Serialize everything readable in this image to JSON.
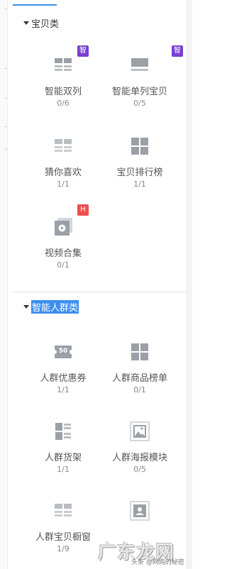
{
  "sections": [
    {
      "title": "宝贝类",
      "items": [
        {
          "label": "智能双列",
          "count": "0/6",
          "icon": "double-column-icon",
          "badge": "智"
        },
        {
          "label": "智能单列宝贝",
          "count": "0/5",
          "icon": "single-column-icon",
          "badge": "智"
        },
        {
          "label": "猜你喜欢",
          "count": "1/1",
          "icon": "double-column-icon"
        },
        {
          "label": "宝贝排行榜",
          "count": "1/1",
          "icon": "grid-icon"
        },
        {
          "label": "视频合集",
          "count": "0/1",
          "icon": "video-icon",
          "badge": "H"
        }
      ]
    },
    {
      "title": "智能人群类",
      "items": [
        {
          "label": "人群优惠券",
          "count": "1/1",
          "icon": "coupon-icon",
          "coupon_text": "50"
        },
        {
          "label": "人群商品榜单",
          "count": "0/1",
          "icon": "grid-icon"
        },
        {
          "label": "人群货架",
          "count": "1/1",
          "icon": "shelf-icon"
        },
        {
          "label": "人群海报模块",
          "count": "0/5",
          "icon": "poster-image-icon"
        },
        {
          "label": "人群宝贝橱窗",
          "count": "1/9",
          "icon": "double-column-icon"
        },
        {
          "label": "",
          "count": "",
          "icon": "user-card-icon"
        }
      ]
    }
  ],
  "watermark": {
    "main": "广东龙网",
    "sub": "头条 @网购的秘密"
  },
  "colors": {
    "accent": "#3c8ef0",
    "badge_purple": "#7a3fd3",
    "badge_red": "#ef4f4f",
    "icon_gray": "#9aa0a6"
  }
}
